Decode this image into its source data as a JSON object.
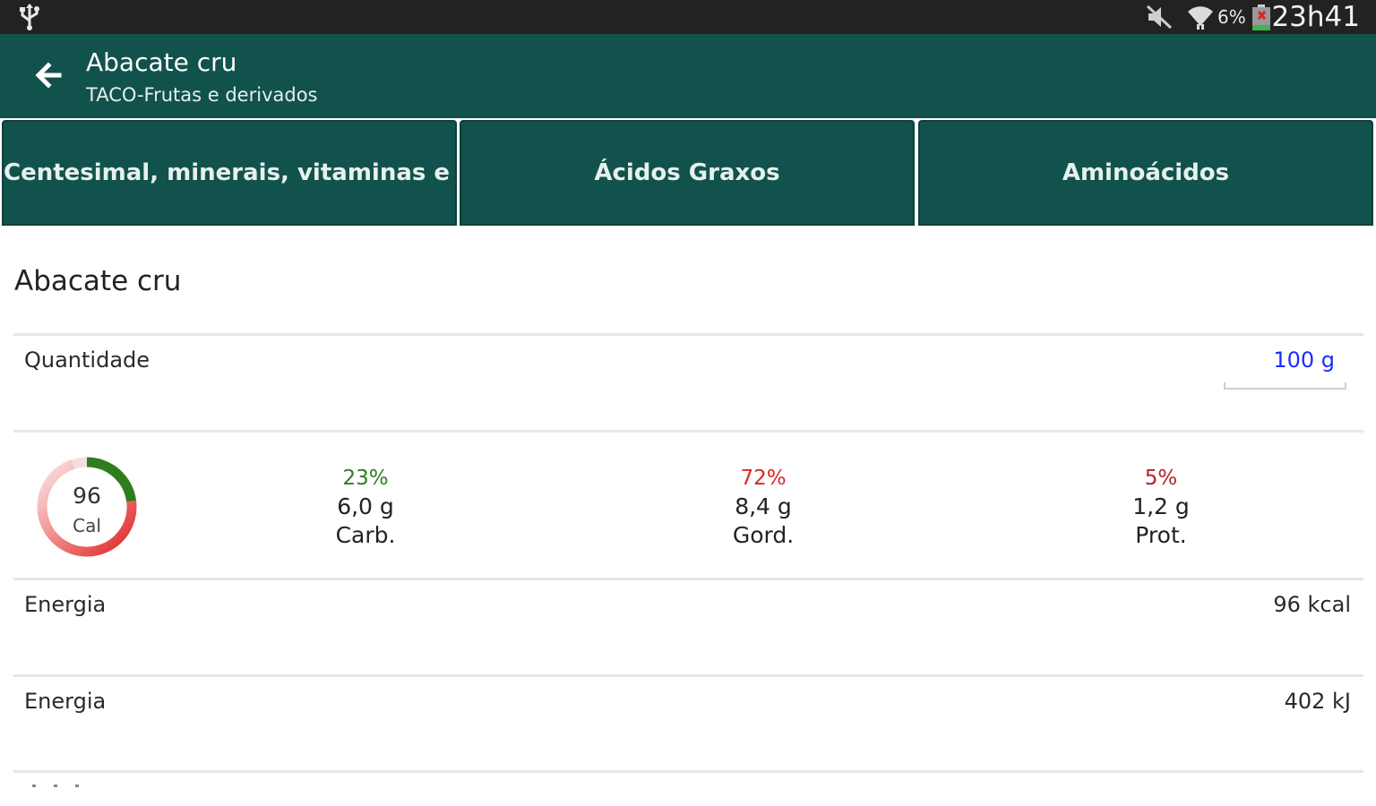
{
  "status_bar": {
    "battery_pct": "6%",
    "time": "23h41",
    "icons": [
      "usb-icon",
      "mute-icon",
      "wifi-icon",
      "battery-low-icon"
    ]
  },
  "app_bar": {
    "title": "Abacate cru",
    "subtitle": "TACO-Frutas e derivados",
    "back_icon": "back-arrow-icon",
    "color": "#12524c"
  },
  "tabs": [
    {
      "label": "Centesimal, minerais, vitaminas e colesterol"
    },
    {
      "label": "Ácidos Graxos"
    },
    {
      "label": "Aminoácidos"
    }
  ],
  "food": {
    "name": "Abacate cru",
    "quantity_label": "Quantidade",
    "quantity_value": "100 g"
  },
  "summary": {
    "calories": "96",
    "calories_unit": "Cal",
    "macros": [
      {
        "pct": "23%",
        "amount": "6,0 g",
        "label": "Carb.",
        "color": "#2e7d1f",
        "fraction": 0.23
      },
      {
        "pct": "72%",
        "amount": "8,4 g",
        "label": "Gord.",
        "color": "#e02424",
        "fraction": 0.72
      },
      {
        "pct": "5%",
        "amount": "1,2 g",
        "label": "Prot.",
        "color": "#b3232a",
        "fraction": 0.05
      }
    ]
  },
  "nutrients": [
    {
      "label": "Energia",
      "value": "96 kcal"
    },
    {
      "label": "Energia",
      "value": "402 kJ"
    }
  ]
}
